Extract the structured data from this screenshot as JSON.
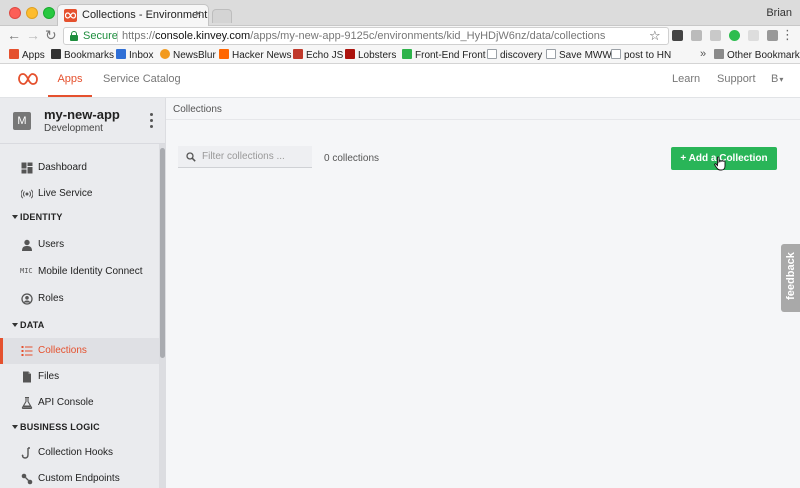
{
  "browser": {
    "tab_title": "Collections - Environment",
    "tab_close": "×",
    "profile_name": "Brian",
    "secure_label": "Secure",
    "url_scheme": "https://",
    "url_host": "console.kinvey.com",
    "url_path": "/apps/my-new-app-9125c/environments/kid_HyHDjW6nz/data/collections",
    "bookmarks": [
      {
        "label": "Apps",
        "icon": "apps-grid-icon",
        "color": "#e5512e"
      },
      {
        "label": "Bookmarks",
        "icon": "star-icon",
        "color": "#333333"
      },
      {
        "label": "Inbox",
        "icon": "inbox-icon",
        "color": "#2f6fd6"
      },
      {
        "label": "NewsBlur",
        "icon": "newsblur-icon",
        "color": "#f29a1f"
      },
      {
        "label": "Hacker News",
        "icon": "hacker-news-icon",
        "color": "#ff6600"
      },
      {
        "label": "Echo JS",
        "icon": "echo-js-icon",
        "color": "#c0392b"
      },
      {
        "label": "Lobsters",
        "icon": "lobsters-icon",
        "color": "#ac130d"
      },
      {
        "label": "Front-End Front",
        "icon": "front-end-front-icon",
        "color": "#2db34a"
      },
      {
        "label": "discovery",
        "icon": "page-icon",
        "color": "#9aa0a6"
      },
      {
        "label": "Save MWW",
        "icon": "page-icon",
        "color": "#9aa0a6"
      },
      {
        "label": "post to HN",
        "icon": "page-icon",
        "color": "#9aa0a6"
      }
    ],
    "bookmarks_overflow": "»",
    "other_bookmarks": "Other Bookmarks"
  },
  "header": {
    "apps": "Apps",
    "service_catalog": "Service Catalog",
    "learn": "Learn",
    "support": "Support",
    "user": "B",
    "accent": "#e5512e"
  },
  "sidebar": {
    "app_initial": "M",
    "app_name": "my-new-app",
    "app_env": "Development",
    "items": [
      {
        "label": "Dashboard"
      },
      {
        "label": "Live Service"
      },
      {
        "section": "IDENTITY"
      },
      {
        "label": "Users"
      },
      {
        "label": "Mobile Identity Connect",
        "icon_text": "MIC"
      },
      {
        "label": "Roles"
      },
      {
        "section": "DATA"
      },
      {
        "label": "Collections"
      },
      {
        "label": "Files"
      },
      {
        "label": "API Console"
      },
      {
        "section": "BUSINESS LOGIC"
      },
      {
        "label": "Collection Hooks"
      },
      {
        "label": "Custom Endpoints"
      }
    ]
  },
  "main": {
    "breadcrumb": "Collections",
    "filter_placeholder": "Filter collections ...",
    "count": "0 collections",
    "add_button": "+ Add a Collection",
    "add_button_color": "#29b558"
  },
  "feedback": "feedback"
}
